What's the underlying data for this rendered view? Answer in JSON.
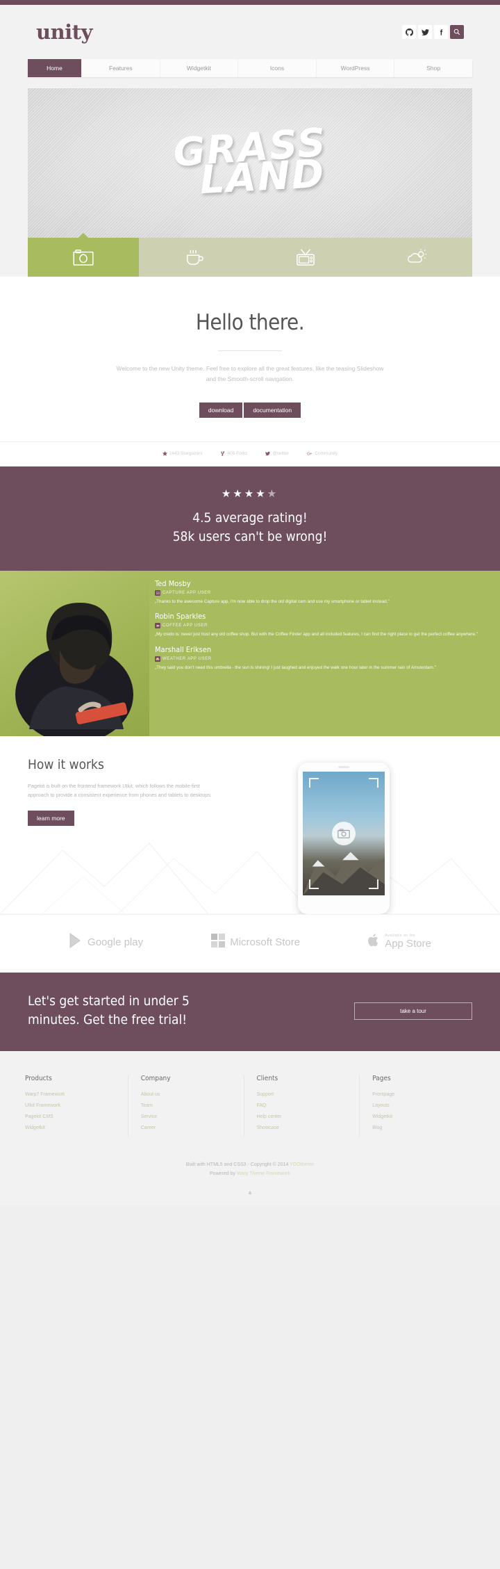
{
  "site": {
    "logo": "unity"
  },
  "social": [
    {
      "name": "github-icon",
      "label": "GitHub"
    },
    {
      "name": "twitter-icon",
      "label": "Twitter"
    },
    {
      "name": "facebook-icon",
      "label": "Facebook"
    },
    {
      "name": "search-icon",
      "label": "Search"
    }
  ],
  "nav": [
    {
      "label": "Home",
      "active": true
    },
    {
      "label": "Features",
      "active": false
    },
    {
      "label": "Widgetkit",
      "active": false
    },
    {
      "label": "Icons",
      "active": false
    },
    {
      "label": "WordPress",
      "active": false
    },
    {
      "label": "Shop",
      "active": false
    }
  ],
  "slideshow": {
    "headline_line1": "GRASS",
    "headline_line2": "LAND",
    "tabs": [
      {
        "icon": "camera-icon",
        "label": "Capture",
        "active": true
      },
      {
        "icon": "coffee-cup-icon",
        "label": "Coffee",
        "active": false
      },
      {
        "icon": "television-icon",
        "label": "TV",
        "active": false
      },
      {
        "icon": "sun-cloud-weather-icon",
        "label": "Weather",
        "active": false
      }
    ]
  },
  "hello": {
    "title": "Hello there.",
    "text": "Welcome to the new Unity theme. Feel free to explore all the great features, like the teasing Slideshow and the Smooth-scroll navigation.",
    "buttons": [
      {
        "label": "download"
      },
      {
        "label": "documentation"
      }
    ]
  },
  "stats": [
    {
      "icon": "star-icon",
      "label": "2443 Stargazers"
    },
    {
      "icon": "fork-icon",
      "label": "405 Forks"
    },
    {
      "icon": "twitter-icon",
      "label": "@twitter"
    },
    {
      "icon": "google-plus-icon",
      "label": "Community"
    }
  ],
  "rating": {
    "stars": "★★★★",
    "half_star": "★",
    "stars_value": 4.5,
    "line1": "4.5 average rating!",
    "line2": "58k users can't be wrong!"
  },
  "testimonials": [
    {
      "name": "Ted Mosby",
      "role": "CAPTURE APP USER",
      "badge": "camera-icon",
      "quote": "„Thanks to the awesome Capture app, I'm now able to drop the old digital cam and use my smartphone or tablet instead.\""
    },
    {
      "name": "Robin Sparkles",
      "role": "COFFEE APP USER",
      "badge": "coffee-cup-icon",
      "quote": "„My credo is: never just trust any old coffee shop. But with the Coffee Finder app and all included features, I can find the right place to get the perfect coffee anywhere.\""
    },
    {
      "name": "Marshall Eriksen",
      "role": "WEATHER APP USER",
      "badge": "cloud-icon",
      "quote": "„They said you don't need this umbrella - the sun is shining! I just laughed and enjoyed the walk one hour later in the summer rain of Amsterdam.\""
    }
  ],
  "how": {
    "title": "How it works",
    "text": "Pagekit is built on the frontend framework UIkit, which follows the mobile-first approach to provide a consistent experience from phones and tablets to desktops.",
    "button": "learn more"
  },
  "stores": [
    {
      "icon": "google-play-icon",
      "name": "Google play",
      "sub": ""
    },
    {
      "icon": "microsoft-store-icon",
      "name": "Microsoft Store",
      "sub": ""
    },
    {
      "icon": "apple-icon",
      "name": "App Store",
      "sub": "Available on the"
    }
  ],
  "cta": {
    "headline": "Let's get started in under 5 minutes. Get the free trial!",
    "button": "take a tour"
  },
  "footer": {
    "columns": [
      {
        "title": "Products",
        "links": [
          "Warp7 Framework",
          "UIkit Framework",
          "Pagekit CMS",
          "Widgetkit"
        ]
      },
      {
        "title": "Company",
        "links": [
          "About us",
          "Team",
          "Service",
          "Career"
        ]
      },
      {
        "title": "Clients",
        "links": [
          "Support",
          "FAQ",
          "Help center",
          "Showcase"
        ]
      },
      {
        "title": "Pages",
        "links": [
          "Frontpage",
          "Layouts",
          "Widgetkit",
          "Blog"
        ]
      }
    ],
    "copyright_prefix": "Built with HTML5 and CSS3 - Copyright © 2014 ",
    "copyright_link": "YOOtheme",
    "powered_prefix": "Powered by ",
    "powered_link": "Warp Theme Framework",
    "to_top": "▲"
  }
}
